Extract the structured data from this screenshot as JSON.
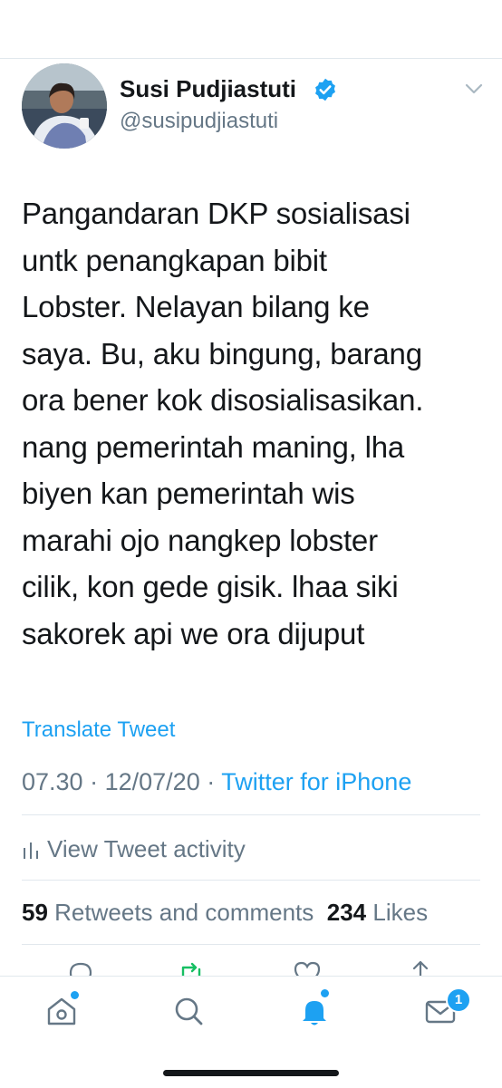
{
  "tweet": {
    "author_name": "Susi Pudjiastuti",
    "author_handle": "@susipudjiastuti",
    "verified": true,
    "text_lines": [
      "Pangandaran DKP sosialisasi",
      "untk penangkapan bibit",
      "Lobster. Nelayan bilang ke",
      "saya. Bu, aku bingung, barang",
      "ora bener kok disosialisasikan.",
      "nang pemerintah maning, lha",
      "biyen kan pemerintah wis",
      "marahi ojo nangkep lobster",
      "cilik, kon gede gisik. lhaa siki",
      "sakorek api we ora dijuput"
    ],
    "translate_label": "Translate Tweet",
    "time": "07.30",
    "separator": "·",
    "date": "12/07/20",
    "source": "Twitter for iPhone",
    "activity_label": "View Tweet activity",
    "retweets_count": "59",
    "retweets_label": "Retweets and comments",
    "likes_count": "234",
    "likes_label": "Likes"
  },
  "tabbar": {
    "items": [
      {
        "icon": "home-icon",
        "active": false,
        "dot": true
      },
      {
        "icon": "search-icon",
        "active": false,
        "dot": false
      },
      {
        "icon": "notifications-bell-icon",
        "active": true,
        "dot": true
      },
      {
        "icon": "messages-envelope-icon",
        "active": false,
        "dot": false
      }
    ],
    "messages_badge": "1"
  },
  "colors": {
    "accent": "#1da1f2",
    "text": "#14171a",
    "muted": "#657786",
    "divider": "#e1e8ed",
    "retweet_green": "#17bf63"
  }
}
